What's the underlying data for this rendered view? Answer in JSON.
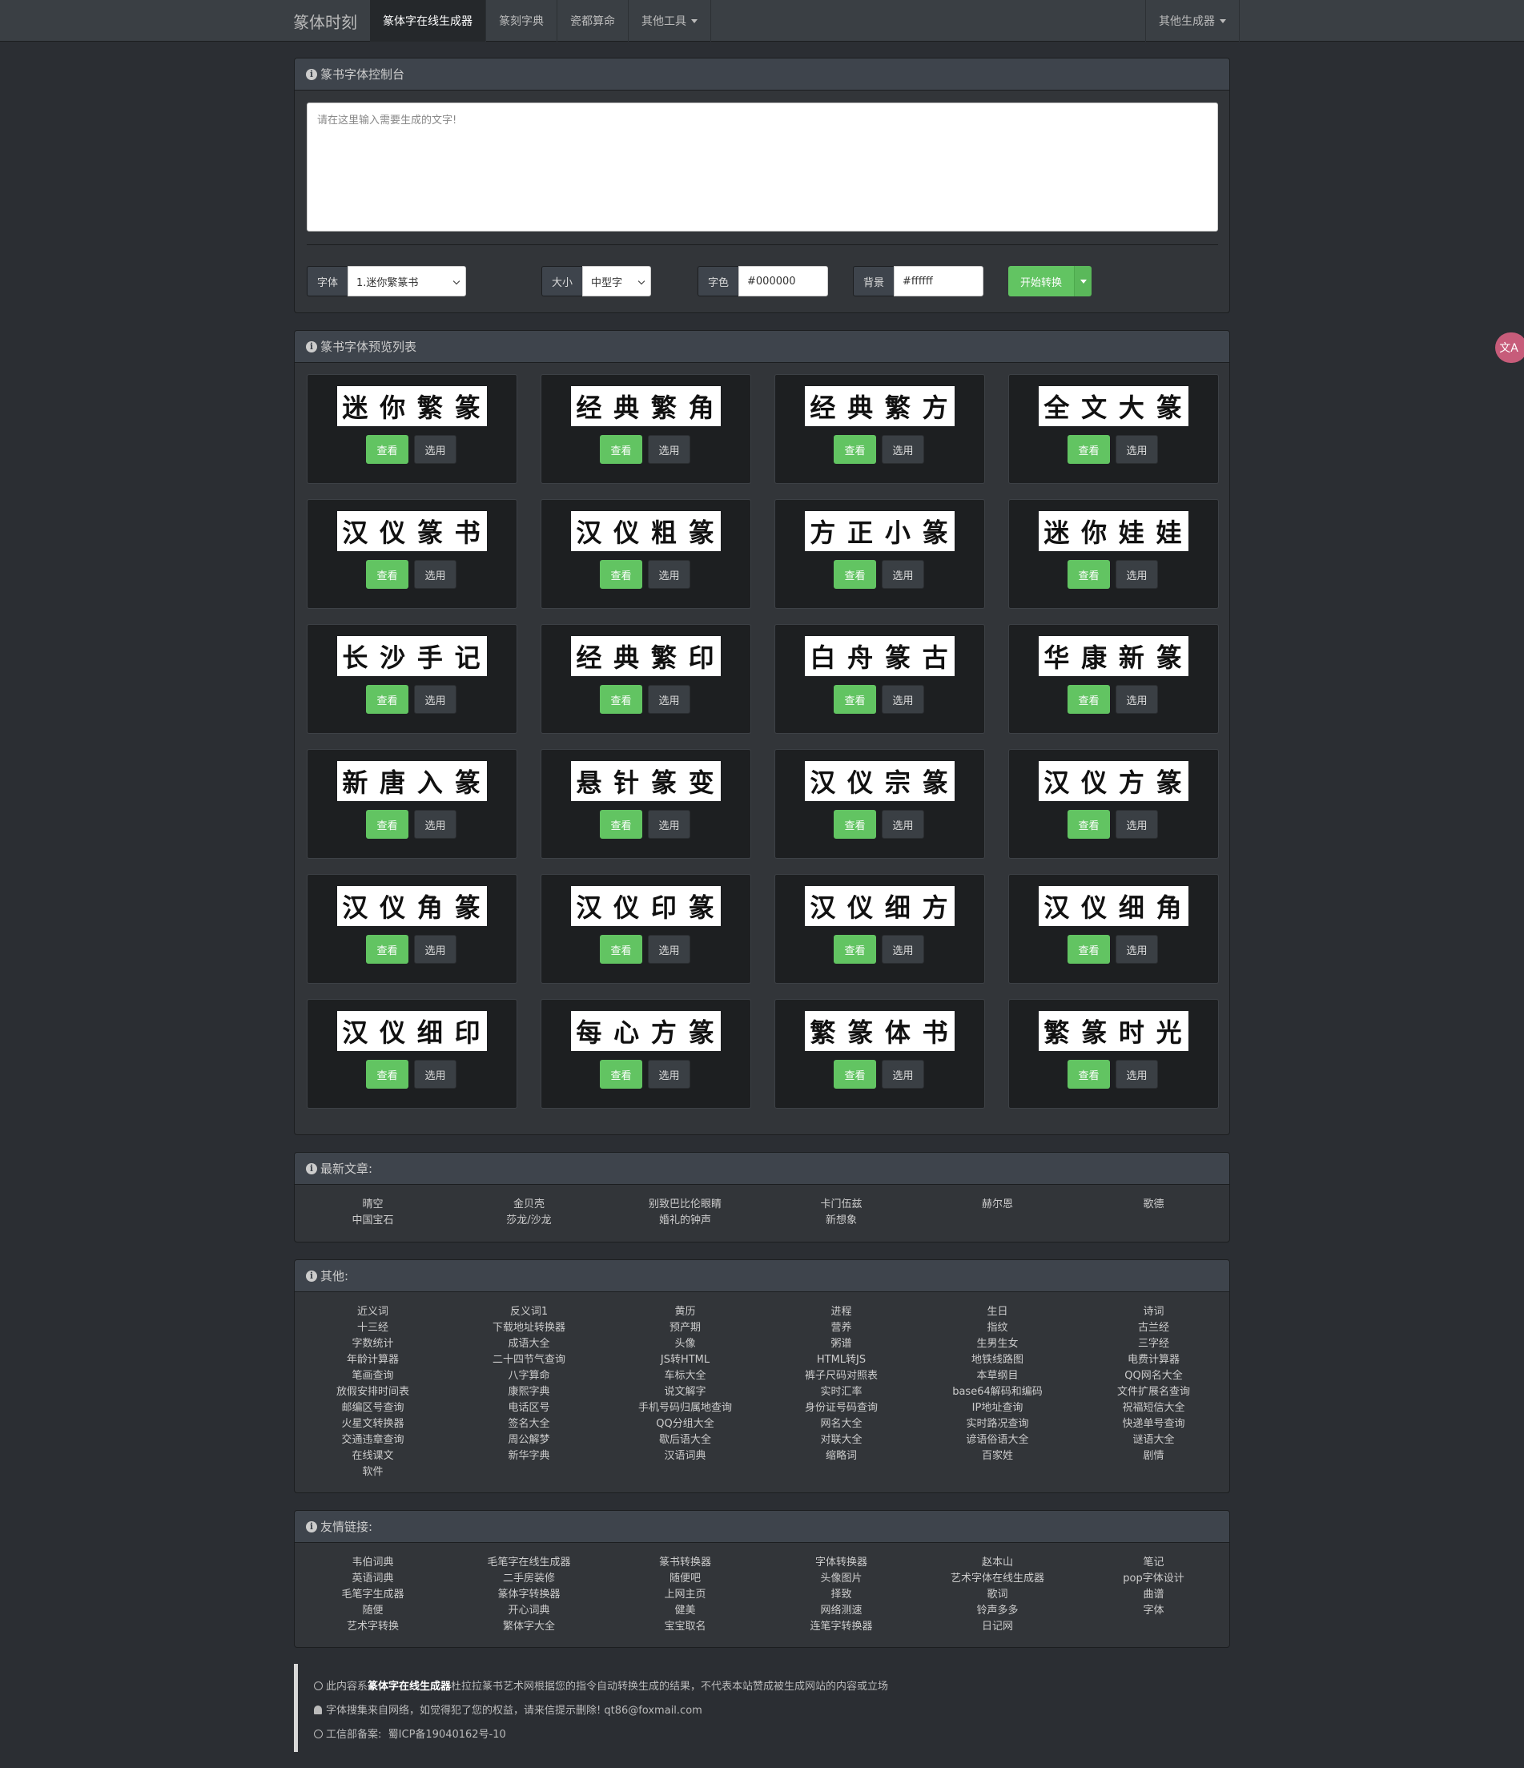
{
  "nav": {
    "brand": "篆体时刻",
    "items": [
      "篆体字在线生成器",
      "篆刻字典",
      "瓷都算命"
    ],
    "tools": "其他工具",
    "right": "其他生成器"
  },
  "console": {
    "title": "篆书字体控制台",
    "placeholder": "请在这里输入需要生成的文字!",
    "font_label": "字体",
    "font_value": "1.迷你繁篆书",
    "size_label": "大小",
    "size_value": "中型字",
    "color_label": "字色",
    "color_value": "#000000",
    "bg_label": "背景",
    "bg_value": "#ffffff",
    "convert": "开始转换"
  },
  "preview": {
    "title": "篆书字体预览列表",
    "view": "查看",
    "select": "选用",
    "cards": [
      [
        "迷",
        "你",
        "繁",
        "篆"
      ],
      [
        "经",
        "典",
        "繁",
        "角"
      ],
      [
        "经",
        "典",
        "繁",
        "方"
      ],
      [
        "全",
        "文",
        "大",
        "篆"
      ],
      [
        "汉",
        "仪",
        "篆",
        "书"
      ],
      [
        "汉",
        "仪",
        "粗",
        "篆"
      ],
      [
        "方",
        "正",
        "小",
        "篆"
      ],
      [
        "迷",
        "你",
        "娃",
        "娃"
      ],
      [
        "长",
        "沙",
        "手",
        "记"
      ],
      [
        "经",
        "典",
        "繁",
        "印"
      ],
      [
        "白",
        "舟",
        "篆",
        "古"
      ],
      [
        "华",
        "康",
        "新",
        "篆"
      ],
      [
        "新",
        "唐",
        "入",
        "篆"
      ],
      [
        "悬",
        "针",
        "篆",
        "变"
      ],
      [
        "汉",
        "仪",
        "宗",
        "篆"
      ],
      [
        "汉",
        "仪",
        "方",
        "篆"
      ],
      [
        "汉",
        "仪",
        "角",
        "篆"
      ],
      [
        "汉",
        "仪",
        "印",
        "篆"
      ],
      [
        "汉",
        "仪",
        "细",
        "方"
      ],
      [
        "汉",
        "仪",
        "细",
        "角"
      ],
      [
        "汉",
        "仪",
        "细",
        "印"
      ],
      [
        "每",
        "心",
        "方",
        "篆"
      ],
      [
        "繁",
        "篆",
        "体",
        "书"
      ],
      [
        "繁",
        "篆",
        "时",
        "光"
      ]
    ]
  },
  "latest": {
    "title": "最新文章:",
    "items": [
      [
        "晴空",
        "中国宝石"
      ],
      [
        "金贝壳",
        "莎龙/沙龙"
      ],
      [
        "别致巴比伦眼睛",
        "婚礼的钟声"
      ],
      [
        "卡门伍兹",
        "新想象"
      ],
      [
        "赫尔恩"
      ],
      [
        "歌德"
      ]
    ]
  },
  "others": {
    "title": "其他:",
    "cols": [
      [
        "近义词",
        "十三经",
        "字数统计",
        "年龄计算器",
        "笔画查询",
        "放假安排时间表",
        "邮编区号查询",
        "火星文转换器",
        "交通违章查询",
        "在线课文",
        "软件"
      ],
      [
        "反义词1",
        "下载地址转换器",
        "成语大全",
        "二十四节气查询",
        "八字算命",
        "康熙字典",
        "电话区号",
        "签名大全",
        "周公解梦",
        "新华字典"
      ],
      [
        "黄历",
        "预产期",
        "头像",
        "JS转HTML",
        "车标大全",
        "说文解字",
        "手机号码归属地查询",
        "QQ分组大全",
        "歇后语大全",
        "汉语词典"
      ],
      [
        "进程",
        "营养",
        "粥谱",
        "HTML转JS",
        "裤子尺码对照表",
        "实时汇率",
        "身份证号码查询",
        "网名大全",
        "对联大全",
        "缩略词"
      ],
      [
        "生日",
        "指纹",
        "生男生女",
        "地铁线路图",
        "本草纲目",
        "base64解码和编码",
        "IP地址查询",
        "实时路况查询",
        "谚语俗语大全",
        "百家姓"
      ],
      [
        "诗词",
        "古兰经",
        "三字经",
        "电费计算器",
        "QQ网名大全",
        "文件扩展名查询",
        "祝福短信大全",
        "快递单号查询",
        "谜语大全",
        "剧情"
      ]
    ]
  },
  "links": {
    "title": "友情链接:",
    "cols": [
      [
        "韦伯词典",
        "英语词典",
        "毛笔字生成器",
        "随便",
        "艺术字转换"
      ],
      [
        "毛笔字在线生成器",
        "二手房装修",
        "篆体字转换器",
        "开心词典",
        "繁体字大全"
      ],
      [
        "篆书转换器",
        "随便吧",
        "上网主页",
        "健美",
        "宝宝取名"
      ],
      [
        "字体转换器",
        "头像图片",
        "择致",
        "网络测速",
        "连笔字转换器"
      ],
      [
        "赵本山",
        "艺术字体在线生成器",
        "歌词",
        "铃声多多",
        "日记网"
      ],
      [
        "笔记",
        "pop字体设计",
        "曲谱",
        "字体"
      ]
    ]
  },
  "footer": {
    "line1_pre": "此内容系",
    "line1_bold": "篆体字在线生成器",
    "line1_post": "杜拉拉篆书艺术网根据您的指令自动转换生成的结果，不代表本站赞成被生成网站的内容或立场",
    "line2": "字体搜集来自网络，如觉得犯了您的权益，请来信提示删除! qt86@foxmail.com",
    "line3_label": "工信部备案:",
    "line3_value": "蜀ICP备19040162号-10"
  },
  "float": "文A"
}
